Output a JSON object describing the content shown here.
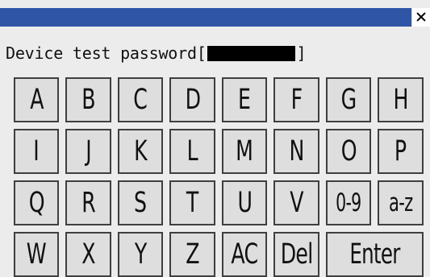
{
  "window": {
    "password_label": "Device test password[",
    "password_close": "]",
    "close_icon": "close-icon"
  },
  "keyboard": {
    "keys": [
      {
        "label": "A"
      },
      {
        "label": "B"
      },
      {
        "label": "C"
      },
      {
        "label": "D"
      },
      {
        "label": "E"
      },
      {
        "label": "F"
      },
      {
        "label": "G"
      },
      {
        "label": "H"
      },
      {
        "label": "I"
      },
      {
        "label": "J"
      },
      {
        "label": "K"
      },
      {
        "label": "L"
      },
      {
        "label": "M"
      },
      {
        "label": "N"
      },
      {
        "label": "O"
      },
      {
        "label": "P"
      },
      {
        "label": "Q"
      },
      {
        "label": "R"
      },
      {
        "label": "S"
      },
      {
        "label": "T"
      },
      {
        "label": "U"
      },
      {
        "label": "V"
      },
      {
        "label": "0-9"
      },
      {
        "label": "a-z"
      },
      {
        "label": "W"
      },
      {
        "label": "X"
      },
      {
        "label": "Y"
      },
      {
        "label": "Z"
      },
      {
        "label": "AC"
      },
      {
        "label": "Del"
      },
      {
        "label": "Enter"
      }
    ]
  },
  "colors": {
    "titlebar": "#2f56a6",
    "background": "#ececec",
    "key_fill": "#dedede",
    "key_border": "#3f3f3f",
    "password_mask": "#000000"
  }
}
